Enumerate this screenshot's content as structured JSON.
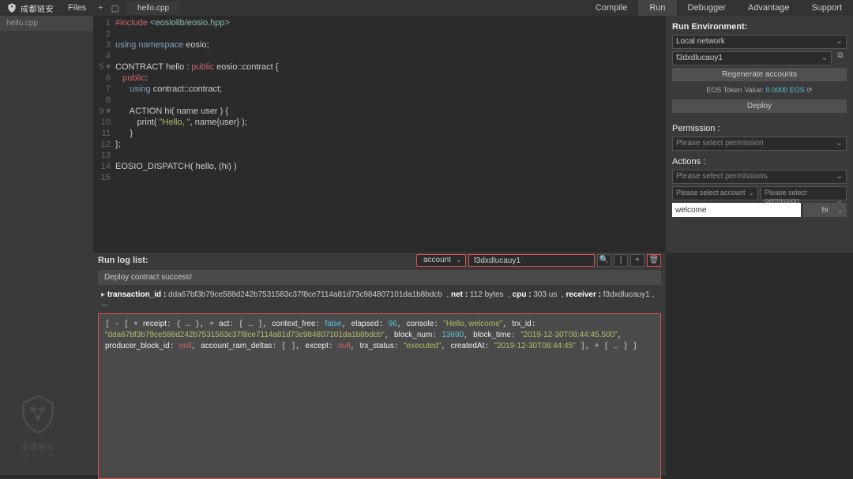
{
  "topbar": {
    "brand": "成都链安",
    "brand_sub": "BEOSIN",
    "files": "Files",
    "tab": "hello.cpp",
    "links": {
      "compile": "Compile",
      "run": "Run",
      "debugger": "Debugger",
      "advantage": "Advantage",
      "support": "Support"
    }
  },
  "sidebar": {
    "file": "hello.cpp"
  },
  "code": {
    "lines": [
      {
        "n": "1",
        "html": "<span class='kw-red'>#include</span> <span class='kw-green'>&lt;eosiolib/eosio.hpp&gt;</span>"
      },
      {
        "n": "2",
        "html": ""
      },
      {
        "n": "3",
        "html": "<span class='kw-blue'>using</span> <span class='kw-blue'>namespace</span> eosio;"
      },
      {
        "n": "4",
        "html": ""
      },
      {
        "n": "5 ▾",
        "html": "CONTRACT hello : <span class='kw-red'>public</span> eosio::contract {"
      },
      {
        "n": "6",
        "html": "   <span class='kw-red'>public</span>:"
      },
      {
        "n": "7",
        "html": "      <span class='kw-blue'>using</span> contract::contract;"
      },
      {
        "n": "8",
        "html": ""
      },
      {
        "n": "9 ▾",
        "html": "      ACTION hi( name user ) {"
      },
      {
        "n": "10",
        "html": "         print( <span class='str'>\"Hello, \"</span>, name{user} );"
      },
      {
        "n": "11",
        "html": "      }"
      },
      {
        "n": "12",
        "html": "};"
      },
      {
        "n": "13",
        "html": ""
      },
      {
        "n": "14",
        "html": "EOSIO_DISPATCH( hello, (hi) )"
      },
      {
        "n": "15",
        "html": ""
      }
    ]
  },
  "rightpanel": {
    "env_title": "Run Environment:",
    "env_net": "Local network",
    "env_acct": "f3dxdlucauy1",
    "regen": "Regenerate accounts",
    "token_label": "EOS Token Value:",
    "token_val": "0.0000 EOS",
    "deploy": "Deploy",
    "perm_title": "Permission :",
    "perm_ph": "Please select permission",
    "actions_title": "Actions :",
    "actions_ph": "Please select permissions",
    "acct_sel_ph": "Please select account",
    "perm_sel_ph": "Please select permission",
    "welcome": "welcome",
    "hi_btn": "hi"
  },
  "log": {
    "title": "Run log list:",
    "acct_label": "account",
    "acct_val": "f3dxdlucauy1",
    "deploy_msg": "Deploy contract success!",
    "tx": {
      "label": "transaction_id :",
      "id": "dda67bf3b79ce588d242b7531583c37f8ce7114a81d73c984807101da1b8bdcb",
      "net_l": "net :",
      "net_v": "112 bytes",
      "cpu_l": "cpu :",
      "cpu_v": "303 us",
      "recv_l": "receiver :",
      "recv_v": "f3dxdlucauy1",
      "more": ", ..."
    },
    "json": {
      "receipt": "receipt",
      "act": "act",
      "context_free": "context_free",
      "context_free_v": "false",
      "elapsed": "elapsed",
      "elapsed_v": "96",
      "console": "console",
      "console_v": "\"Hello, welcome\"",
      "trx_id": "trx_id",
      "trx_id_v": "\"dda67bf3b79ce588d242b7531583c37f8ce7114a81d73c984807101da1b8bdcb\"",
      "block_num": "block_num",
      "block_num_v": "13690",
      "block_time": "block_time",
      "block_time_v": "\"2019-12-30T08:44:45.500\"",
      "producer_block_id": "producer_block_id",
      "producer_block_id_v": "null",
      "account_ram_deltas": "account_ram_deltas",
      "except": "except",
      "except_v": "null",
      "trx_status": "trx_status",
      "trx_status_v": "\"executed\"",
      "createdAt": "createdAt",
      "createdAt_v": "\"2019-12-30T08:44:45\""
    }
  },
  "watermark": {
    "cn": "成都链安",
    "en": "BEOSIN"
  }
}
